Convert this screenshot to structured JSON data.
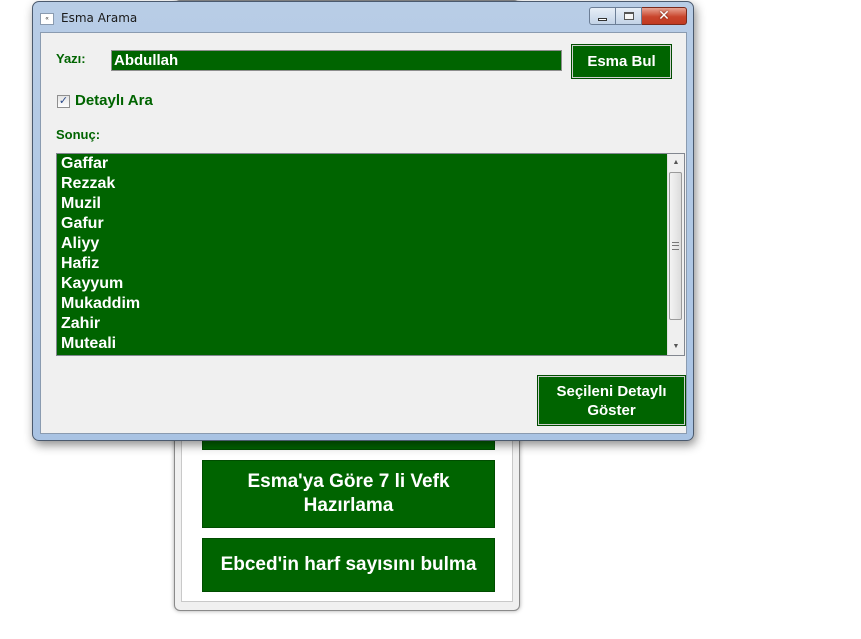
{
  "background_window": {
    "buttons": [
      {
        "label": "Esma'ya Göre 7 li Vefk\nHazırlama"
      },
      {
        "label": "Ebced'in harf sayısını bulma"
      }
    ]
  },
  "dialog": {
    "title": "Esma Arama",
    "icon": "app-icon",
    "caption": {
      "minimize_icon": "minimize-icon",
      "maximize_icon": "maximize-icon",
      "close_icon": "close-icon",
      "close_glyph": "✕"
    },
    "text_label": "Yazı:",
    "text_value": "Abdullah",
    "search_button": "Esma Bul",
    "detail_checkbox": {
      "label": "Detaylı Ara",
      "checked": true,
      "mark": "✓"
    },
    "result_label": "Sonuç:",
    "results": [
      "Gaffar",
      "Rezzak",
      "Muzil",
      "Gafur",
      "Aliyy",
      "Hafiz",
      "Kayyum",
      "Mukaddim",
      "Zahir",
      "Muteali"
    ],
    "show_detail_button": "Seçileni Detaylı\nGöster",
    "scroll_up": "▲",
    "scroll_down": "▼"
  },
  "colors": {
    "accent": "#006400",
    "text_on_accent": "#ffffff"
  }
}
